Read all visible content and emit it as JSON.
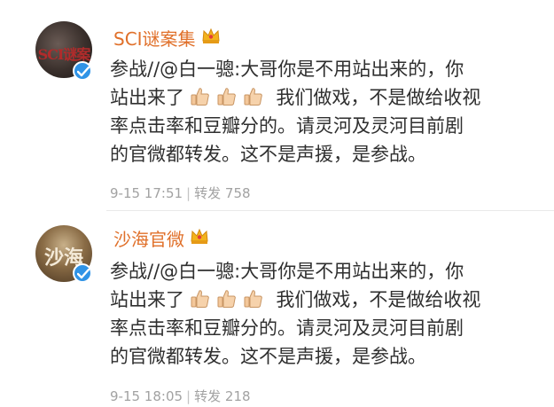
{
  "posts": [
    {
      "account_name": "SCI谜案集",
      "avatar_text": "SCI谜案",
      "line1_prefix": "参战//",
      "mention": "@白一骢",
      "line1_suffix": ":大哥你是不用站出来的，你",
      "line2_before": "站出来了",
      "line2_after": "我们做戏，不是做给收视",
      "line3": "率点击率和豆瓣分的。请灵河及灵河目前剧",
      "line4": "的官微都转发。这不是声援，是参战。",
      "timestamp": "9-15 17:51",
      "repost_label": "转发",
      "repost_count": "758"
    },
    {
      "account_name": "沙海官微",
      "avatar_text": "沙海",
      "line1_prefix": "参战//",
      "mention": "@白一骢",
      "line1_suffix": ":大哥你是不用站出来的，你",
      "line2_before": "站出来了",
      "line2_after": "我们做戏，不是做给收视",
      "line3": "率点击率和豆瓣分的。请灵河及灵河目前剧",
      "line4": "的官微都转发。这不是声援，是参战。",
      "timestamp": "9-15 18:05",
      "repost_label": "转发",
      "repost_count": "218"
    }
  ],
  "icons": {
    "thumbs_up": "thumbs-up-emoji",
    "verified": "verified-badge-icon",
    "crown": "vip-crown-icon"
  },
  "colors": {
    "account_name": "#e0702a",
    "verified": "#2f93e6",
    "meta": "#a2a2a2"
  }
}
